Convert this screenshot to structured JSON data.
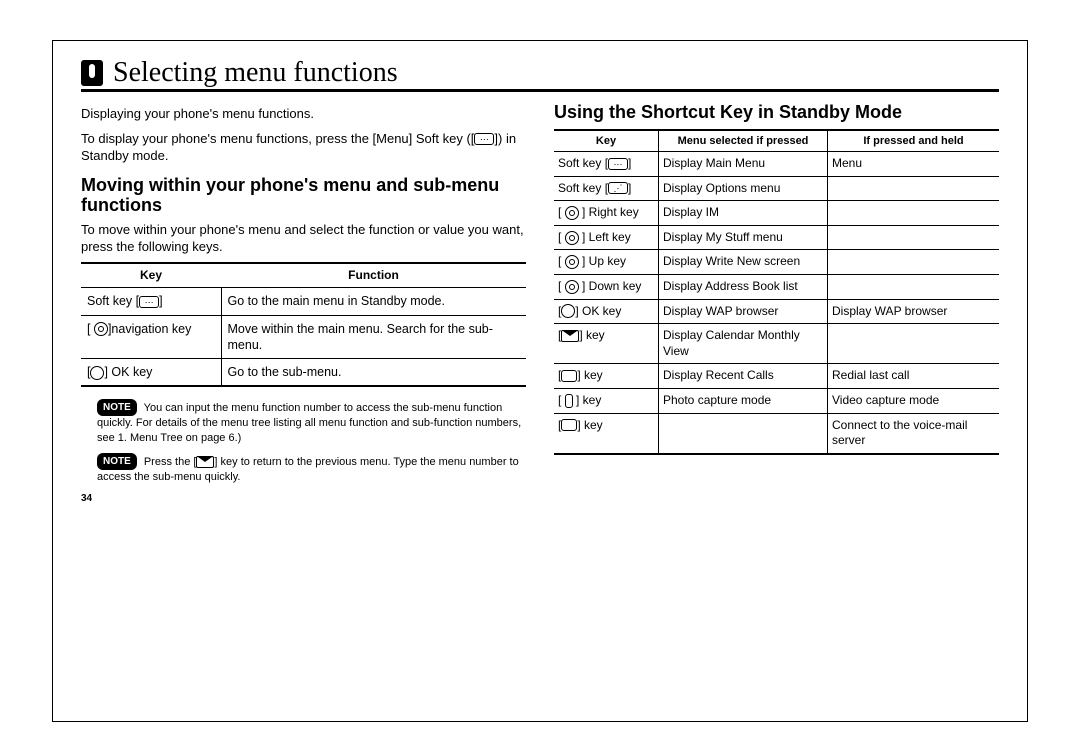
{
  "page_number": "34",
  "chapter_title": "Selecting menu functions",
  "left": {
    "intro_line1": "Displaying your phone's menu functions.",
    "intro_line2_a": "To display your phone's menu functions, press the [Menu] Soft key ([",
    "intro_line2_b": "]) in Standby mode.",
    "heading": "Moving within your phone's menu and sub-menu functions",
    "body": "To move within your phone's menu and select the function or value you want, press the following keys.",
    "table_headers": [
      "Key",
      "Function"
    ],
    "table_rows": [
      {
        "key_pre": "Soft key [",
        "key_icon": "softleft",
        "key_post": "]",
        "func": "Go to the main menu in Standby mode."
      },
      {
        "key_pre": "[ ",
        "key_icon": "navcircle",
        "key_post": "]navigation key",
        "func": "Move within the main menu. Search for the sub-menu."
      },
      {
        "key_pre": "[",
        "key_icon": "ok",
        "key_post": "] OK key",
        "func": "Go to the sub-menu."
      }
    ],
    "note1_a": "You can input the menu function number to access the sub-menu function quickly. For details of the menu tree listing all menu function and sub-function numbers, see 1. Menu Tree on page 6.)",
    "note2_a": "Press the [",
    "note2_b": "] key to return to the previous menu. Type the menu number to access the sub-menu quickly.",
    "note_label": "NOTE"
  },
  "right": {
    "heading": "Using the Shortcut Key in Standby Mode",
    "table_headers": [
      "Key",
      "Menu selected if pressed",
      "If pressed and held"
    ],
    "table_rows": [
      {
        "k_pre": "Soft key [",
        "k_icon": "softleft",
        "k_post": "]",
        "m": "Display Main Menu",
        "h": "Menu"
      },
      {
        "k_pre": "Soft key [",
        "k_icon": "softright",
        "k_post": "]",
        "m": "Display Options menu",
        "h": ""
      },
      {
        "k_pre": "[ ",
        "k_icon": "navcircle",
        "k_post": " ] Right key",
        "m": "Display IM",
        "h": ""
      },
      {
        "k_pre": "[ ",
        "k_icon": "navcircle",
        "k_post": " ] Left key",
        "m": "Display My Stuff menu",
        "h": ""
      },
      {
        "k_pre": "[ ",
        "k_icon": "navcircle",
        "k_post": " ] Up key",
        "m": "Display Write New screen",
        "h": ""
      },
      {
        "k_pre": "[ ",
        "k_icon": "navcircle",
        "k_post": " ] Down key",
        "m": "Display Address Book list",
        "h": ""
      },
      {
        "k_pre": "[",
        "k_icon": "ok",
        "k_post": "] OK key",
        "m": "Display WAP browser",
        "h": "Display WAP browser"
      },
      {
        "k_pre": "[",
        "k_icon": "msg",
        "k_post": "] key",
        "m": "Display Calendar Monthly View",
        "h": ""
      },
      {
        "k_pre": "[",
        "k_icon": "send",
        "k_post": "] key",
        "m": "Display Recent Calls",
        "h": "Redial last call"
      },
      {
        "k_pre": "[ ",
        "k_icon": "cam",
        "k_post": " ] key",
        "m": "Photo capture mode",
        "h": "Video capture mode"
      },
      {
        "k_pre": "[",
        "k_icon": "send",
        "k_post": "] key",
        "m": "",
        "h": "Connect to the voice-mail server"
      }
    ]
  }
}
